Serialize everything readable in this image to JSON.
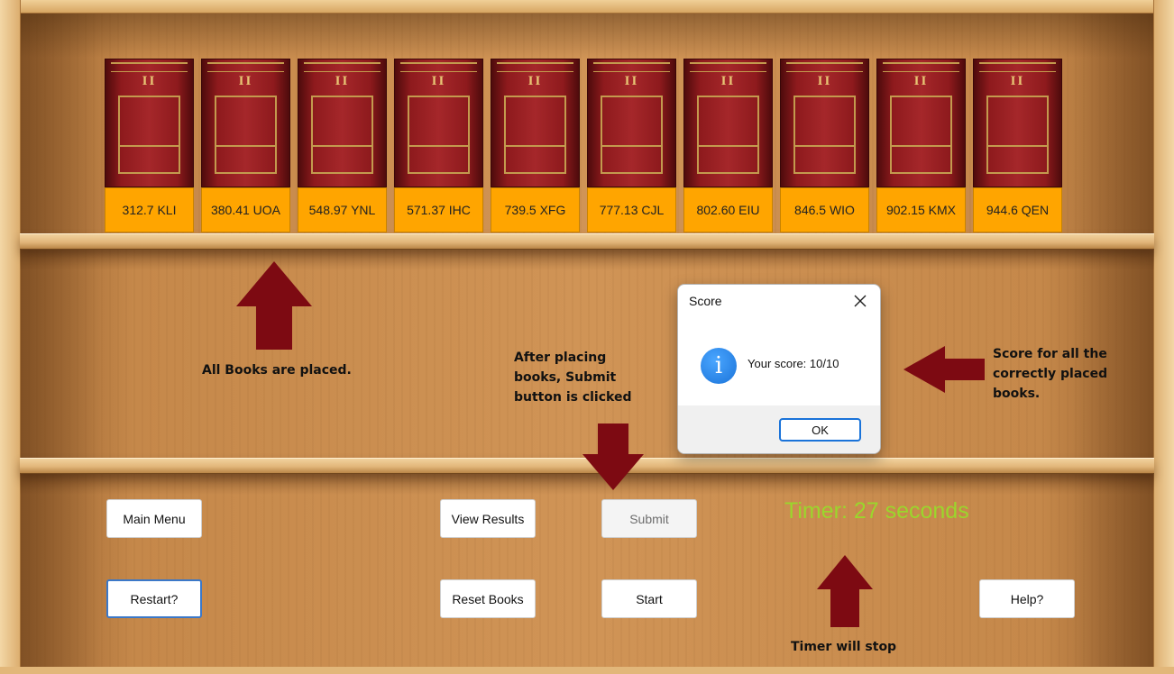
{
  "books": [
    {
      "numeral": "II",
      "label": "312.7 KLI"
    },
    {
      "numeral": "II",
      "label": "380.41 UOA"
    },
    {
      "numeral": "II",
      "label": "548.97 YNL"
    },
    {
      "numeral": "II",
      "label": "571.37 IHC"
    },
    {
      "numeral": "II",
      "label": "739.5 XFG"
    },
    {
      "numeral": "II",
      "label": "777.13 CJL"
    },
    {
      "numeral": "II",
      "label": "802.60 EIU"
    },
    {
      "numeral": "II",
      "label": "846.5 WIO"
    },
    {
      "numeral": "II",
      "label": "902.15 KMX"
    },
    {
      "numeral": "II",
      "label": "944.6 QEN"
    }
  ],
  "annotations": {
    "books_placed": "All Books are placed.",
    "submit_clicked": [
      "After placing",
      "books, Submit",
      "button is clicked"
    ],
    "score_note": [
      "Score for all the",
      "correctly placed",
      "books."
    ],
    "timer_note": "Timer will stop"
  },
  "buttons": {
    "main_menu": "Main Menu",
    "view_results": "View Results",
    "submit": "Submit",
    "restart": "Restart?",
    "reset_books": "Reset Books",
    "start": "Start",
    "help": "Help?"
  },
  "timer": {
    "text": "Timer: 27 seconds",
    "color": "#9bd62c"
  },
  "dialog": {
    "title": "Score",
    "message": "Your score: 10/10",
    "ok_label": "OK",
    "icon": "info-icon"
  },
  "colors": {
    "book_tag": "#ffa500",
    "book_spine": "#8e1a1d",
    "arrow": "#7d0a12",
    "timer": "#9bd62c"
  }
}
